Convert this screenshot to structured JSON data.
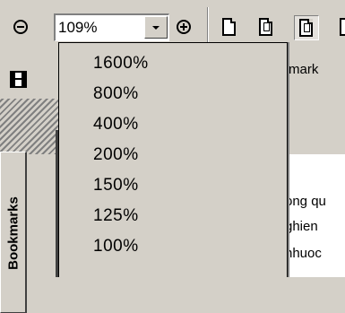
{
  "toolbar": {
    "zoom_value": "109%",
    "icons": [
      "zoom-out-icon",
      "zoom-combo-arrow",
      "zoom-in-icon",
      "actual-size-icon",
      "fit-page-icon",
      "fit-width-icon"
    ]
  },
  "zoom_menu": {
    "options": [
      "1600%",
      "800%",
      "400%",
      "200%",
      "150%",
      "125%",
      "100%"
    ]
  },
  "navigation": {
    "bookmarks_tab": "Bookmarks"
  },
  "document": {
    "tab_label": "mark",
    "lines": [
      "ong qu",
      "ghien",
      "nhuoc"
    ]
  }
}
